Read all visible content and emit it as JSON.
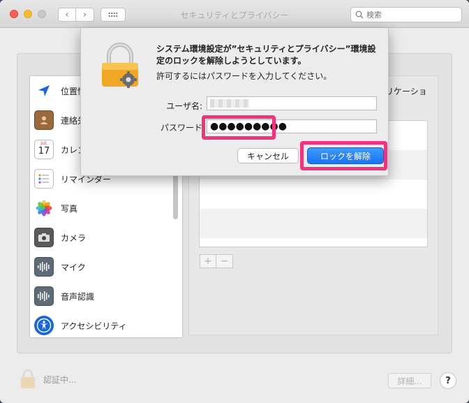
{
  "window": {
    "title": "セキュリティとプライバシー"
  },
  "search": {
    "placeholder": "検索"
  },
  "sidebar": {
    "items": [
      {
        "label": "位置情",
        "icon": "location-arrow-icon"
      },
      {
        "label": "連絡先",
        "icon": "contacts-book-icon"
      },
      {
        "label": "カレン",
        "icon": "calendar-icon",
        "calendar_month": "JUL",
        "calendar_day": "17"
      },
      {
        "label": "リマインダー",
        "icon": "reminders-list-icon"
      },
      {
        "label": "写真",
        "icon": "photos-flower-icon"
      },
      {
        "label": "カメラ",
        "icon": "camera-icon"
      },
      {
        "label": "マイク",
        "icon": "microphone-waveform-icon"
      },
      {
        "label": "音声認識",
        "icon": "speech-waveform-icon"
      },
      {
        "label": "アクセシビリティ",
        "icon": "accessibility-icon"
      }
    ]
  },
  "right_panel": {
    "header": "リケーショ"
  },
  "list_controls": {
    "add": "+",
    "remove": "−"
  },
  "footer": {
    "lock_label": "認証中...",
    "advanced_label": "詳細...",
    "help_label": "?"
  },
  "sheet": {
    "title": "システム環境設定が”セキュリティとプライバシー”環境設定のロックを解除しようとしています。",
    "subtitle": "許可するにはパスワードを入力してください。",
    "username_label": "ユーザ名:",
    "password_label": "パスワード",
    "password_value": "●●●●●●●●●",
    "cancel_label": "キャンセル",
    "unlock_label": "ロックを解除"
  },
  "colors": {
    "highlight": "#f0337a",
    "accent": "#1b73f3"
  }
}
